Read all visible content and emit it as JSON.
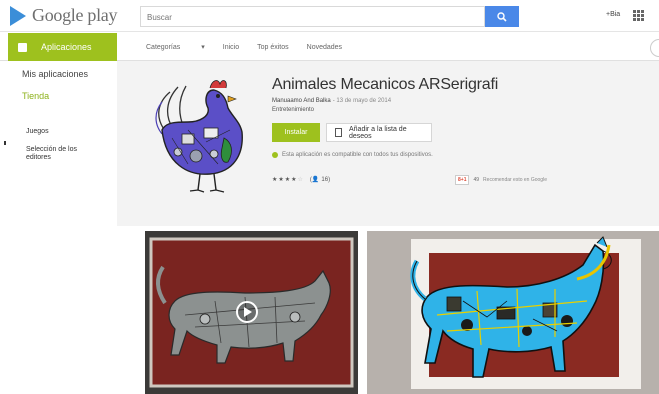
{
  "header": {
    "logo_text": "Google play",
    "search_placeholder": "Buscar",
    "plus_user": "+Bia"
  },
  "nav": {
    "active_section": "Aplicaciones",
    "links": [
      "Categorías",
      "Inicio",
      "Top éxitos",
      "Novedades"
    ]
  },
  "sidebar": {
    "items": [
      {
        "label": "Mis aplicaciones"
      },
      {
        "label": "Tienda"
      }
    ],
    "sub_items": [
      {
        "label": "Juegos"
      },
      {
        "label": "Selección de los editores"
      }
    ]
  },
  "app": {
    "title": "Animales Mecanicos ARSerigrafi",
    "developer": "Manuaamo And Balka",
    "date": "- 13 de mayo de 2014",
    "category": "Entretenimiento",
    "install_label": "Instalar",
    "wishlist_label": "Añadir a la lista de deseos",
    "compat_text": "Esta aplicación es compatible con todos tus dispositivos.",
    "stars": "★★★★",
    "star_empty": "☆",
    "reviews": "16",
    "gplus_label": "8+1",
    "gplus_count": "49",
    "gplus_text": "Recomendar esto en Google"
  },
  "colors": {
    "accent_green": "#9ec11e",
    "search_blue": "#4a88e8"
  },
  "icons": {
    "search": "search-icon",
    "apps": "apps-grid-icon",
    "bookmark": "bookmark-icon",
    "play": "play-icon",
    "bag": "shopping-bag-icon"
  }
}
